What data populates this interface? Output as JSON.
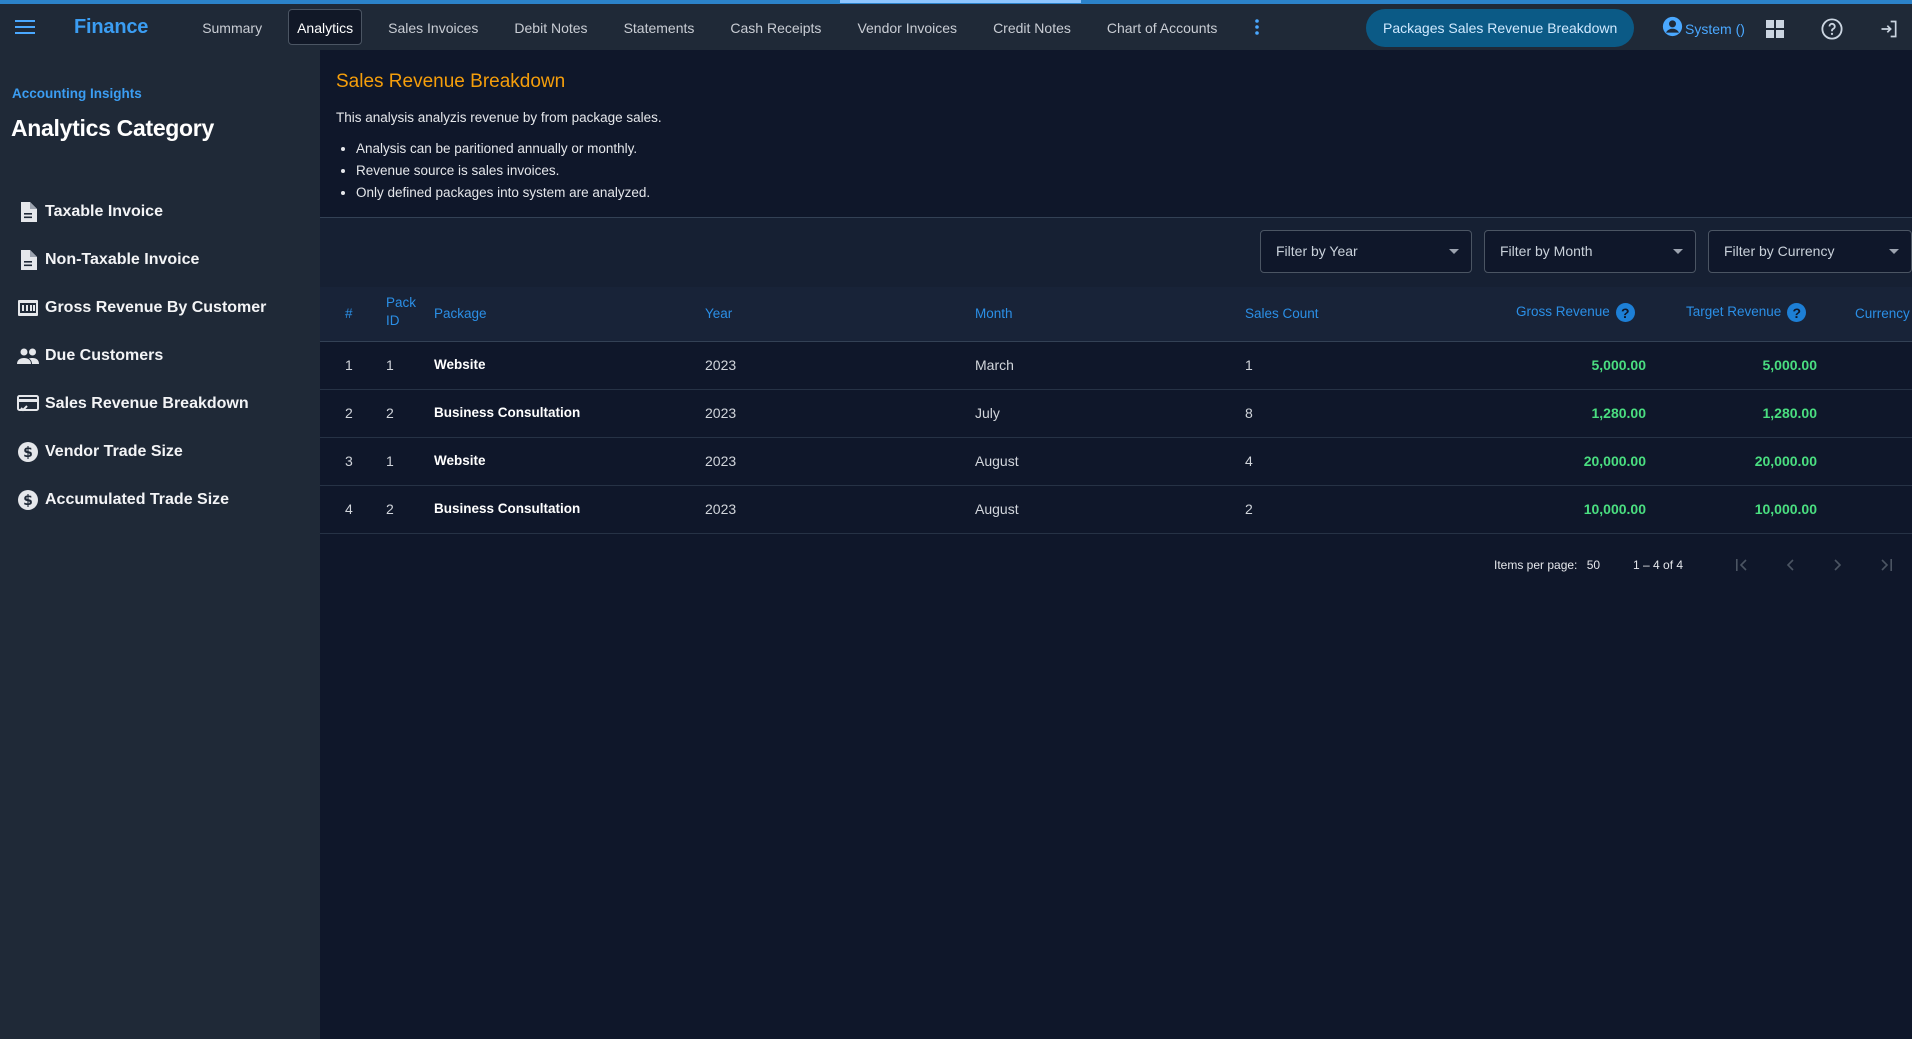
{
  "app": {
    "title": "Finance"
  },
  "nav": {
    "items": [
      {
        "label": "Summary"
      },
      {
        "label": "Analytics",
        "active": true
      },
      {
        "label": "Sales Invoices"
      },
      {
        "label": "Debit Notes"
      },
      {
        "label": "Statements"
      },
      {
        "label": "Cash Receipts"
      },
      {
        "label": "Vendor Invoices"
      },
      {
        "label": "Credit Notes"
      },
      {
        "label": "Chart of Accounts"
      }
    ],
    "more_icon": "more-vert-icon"
  },
  "header": {
    "pill_label": "Packages Sales Revenue Breakdown",
    "user_label": "System ()",
    "icons": [
      "account-circle-icon",
      "apps-grid-icon",
      "help-icon",
      "logout-icon"
    ]
  },
  "sidebar": {
    "eyebrow": "Accounting Insights",
    "title": "Analytics Category",
    "items": [
      {
        "label": "Taxable Invoice",
        "icon": "document-icon"
      },
      {
        "label": "Non-Taxable Invoice",
        "icon": "document-icon"
      },
      {
        "label": "Gross Revenue By Customer",
        "icon": "register-icon"
      },
      {
        "label": "Due Customers",
        "icon": "people-icon"
      },
      {
        "label": "Sales Revenue Breakdown",
        "icon": "card-check-icon"
      },
      {
        "label": "Vendor Trade Size",
        "icon": "dollar-circle-icon"
      },
      {
        "label": "Accumulated Trade Size",
        "icon": "dollar-circle-icon"
      }
    ]
  },
  "main": {
    "title": "Sales Revenue Breakdown",
    "description": "This analysis analyzis revenue by from package sales.",
    "bullets": [
      "Analysis can be paritioned annually or monthly.",
      "Revenue source is sales invoices.",
      "Only defined packages into system are analyzed."
    ]
  },
  "filters": {
    "year": "Filter by Year",
    "month": "Filter by Month",
    "currency": "Filter by Currency"
  },
  "table": {
    "headers": {
      "num": "#",
      "pack_id_1": "Pack",
      "pack_id_2": "ID",
      "package": "Package",
      "year": "Year",
      "month": "Month",
      "sales_count": "Sales Count",
      "gross_revenue": "Gross Revenue",
      "target_revenue": "Target Revenue",
      "currency": "Currency"
    },
    "rows": [
      {
        "num": "1",
        "pack_id": "1",
        "package": "Website",
        "year": "2023",
        "month": "March",
        "sales_count": "1",
        "gross": "5,000.00",
        "target": "5,000.00"
      },
      {
        "num": "2",
        "pack_id": "2",
        "package": "Business Consultation",
        "year": "2023",
        "month": "July",
        "sales_count": "8",
        "gross": "1,280.00",
        "target": "1,280.00"
      },
      {
        "num": "3",
        "pack_id": "1",
        "package": "Website",
        "year": "2023",
        "month": "August",
        "sales_count": "4",
        "gross": "20,000.00",
        "target": "20,000.00"
      },
      {
        "num": "4",
        "pack_id": "2",
        "package": "Business Consultation",
        "year": "2023",
        "month": "August",
        "sales_count": "2",
        "gross": "10,000.00",
        "target": "10,000.00"
      }
    ]
  },
  "pagination": {
    "items_per_page_label": "Items per page:",
    "items_per_page": "50",
    "range": "1 – 4 of 4"
  },
  "colors": {
    "accent": "#3b9df2",
    "title_orange": "#f59e0b",
    "money_green": "#4ade80",
    "pill_bg": "#0b5a86"
  }
}
